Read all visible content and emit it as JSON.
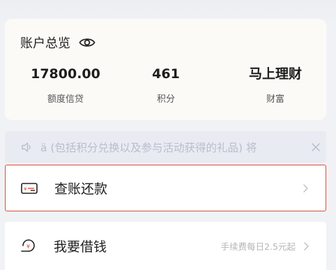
{
  "overview": {
    "title": "账户总览",
    "stats": [
      {
        "value": "17800.00",
        "label": "额度信贷"
      },
      {
        "value": "461",
        "label": "积分"
      },
      {
        "value": "马上理财",
        "label": "财富"
      }
    ]
  },
  "notice": {
    "text": "ä (包括积分兑换以及参与活动获得的礼品) 将"
  },
  "list": {
    "items": [
      {
        "label": "查账还款",
        "hint": ""
      },
      {
        "label": "我要借钱",
        "hint": "手续费每日2.5元起"
      }
    ]
  },
  "colors": {
    "accent_red": "#e04b3b",
    "background": "#f1f2f5",
    "card": "#fbfaf6"
  },
  "icons": {
    "eye": "eye-icon",
    "speaker": "speaker-icon",
    "close": "close-icon",
    "bill": "bill-icon",
    "borrow": "borrow-icon",
    "chevron": "chevron-right-icon"
  }
}
